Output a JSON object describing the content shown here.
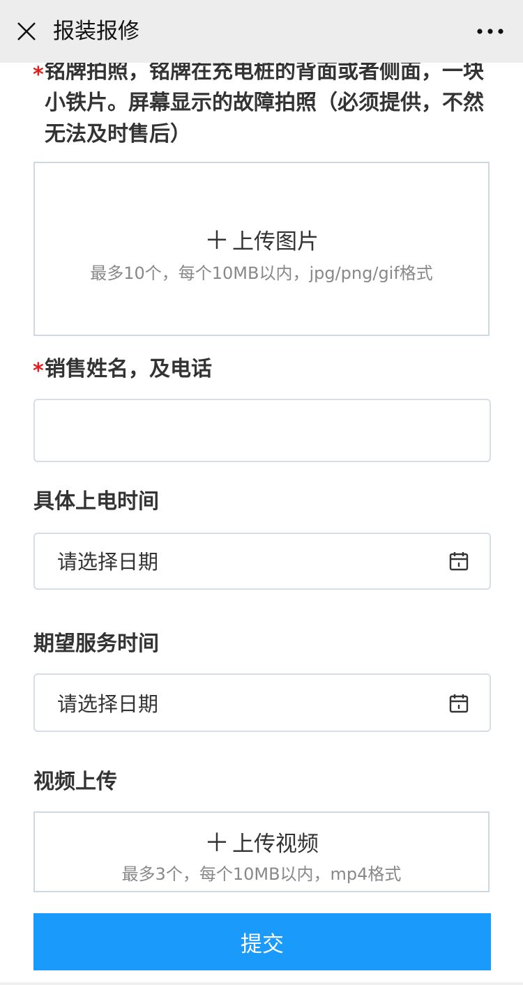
{
  "header": {
    "title": "报装报修",
    "close_icon": "close-icon",
    "more_icon": "more-icon"
  },
  "form": {
    "photo_field": {
      "required_mark": "*",
      "label": "铭牌拍照，铭牌在充电桩的背面或者侧面，一块小铁片。屏幕显示的故障拍照（必须提供，不然无法及时售后）",
      "upload_text": "上传图片",
      "upload_hint": "最多10个，每个10MB以内，jpg/png/gif格式"
    },
    "sales_field": {
      "required_mark": "*",
      "label": "销售姓名，及电话",
      "value": ""
    },
    "power_on_time": {
      "label": "具体上电时间",
      "placeholder": "请选择日期"
    },
    "service_time": {
      "label": "期望服务时间",
      "placeholder": "请选择日期"
    },
    "video_field": {
      "label": "视频上传",
      "upload_text": "上传视频",
      "upload_hint": "最多3个，每个10MB以内，mp4格式"
    },
    "submit_label": "提交"
  },
  "colors": {
    "accent": "#1a9bfc",
    "required": "#e02020",
    "header_bg": "#ededed"
  }
}
